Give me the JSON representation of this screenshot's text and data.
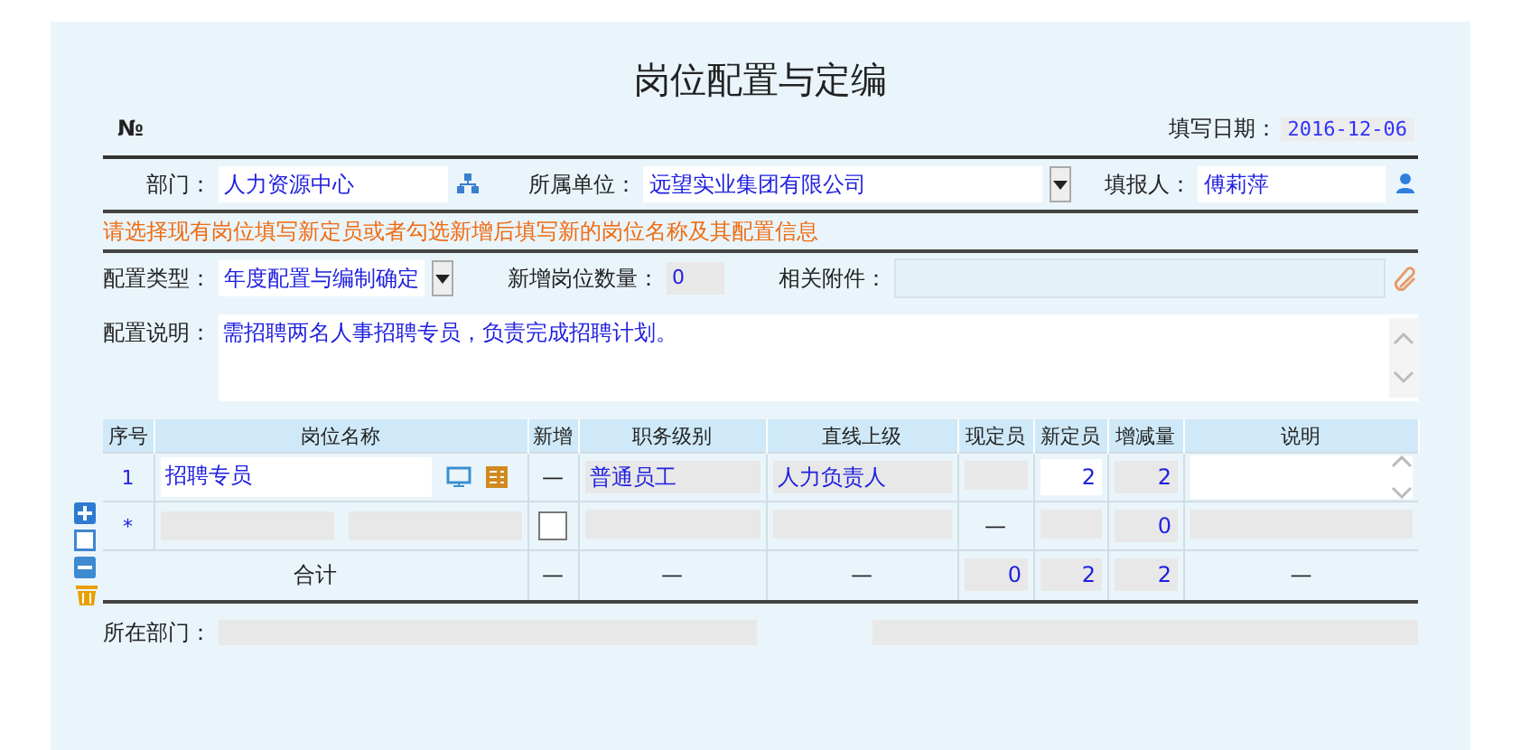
{
  "title": "岗位配置与定编",
  "number_sign": "№",
  "fill_date": {
    "label": "填写日期：",
    "value": "2016-12-06"
  },
  "department": {
    "label": "部门：",
    "value": "人力资源中心"
  },
  "affiliation": {
    "label": "所属单位：",
    "value": "远望实业集团有限公司"
  },
  "filler": {
    "label": "填报人：",
    "value": "傅莉萍"
  },
  "hint": "请选择现有岗位填写新定员或者勾选新增后填写新的岗位名称及其配置信息",
  "config_type": {
    "label": "配置类型：",
    "value": "年度配置与编制确定"
  },
  "new_positions": {
    "label": "新增岗位数量：",
    "value": "0"
  },
  "attachments": {
    "label": "相关附件："
  },
  "description": {
    "label": "配置说明：",
    "value": "需招聘两名人事招聘专员，负责完成招聘计划。"
  },
  "table": {
    "columns": [
      "序号",
      "岗位名称",
      "新增",
      "职务级别",
      "直线上级",
      "现定员",
      "新定员",
      "增减量",
      "说明"
    ],
    "rows": [
      {
        "kind": "existing",
        "seq": "1",
        "name": "招聘专员",
        "new": "—",
        "level": "普通员工",
        "superior": "人力负责人",
        "planned": "2",
        "change": "2"
      },
      {
        "kind": "new",
        "seq": "*",
        "checked": false,
        "current": "—",
        "change": "0"
      }
    ],
    "total": {
      "label": "合计",
      "new": "—",
      "level": "—",
      "superior": "—",
      "current": "0",
      "planned": "2",
      "change": "2",
      "note": "—"
    }
  },
  "location": {
    "label": "所在部门："
  }
}
